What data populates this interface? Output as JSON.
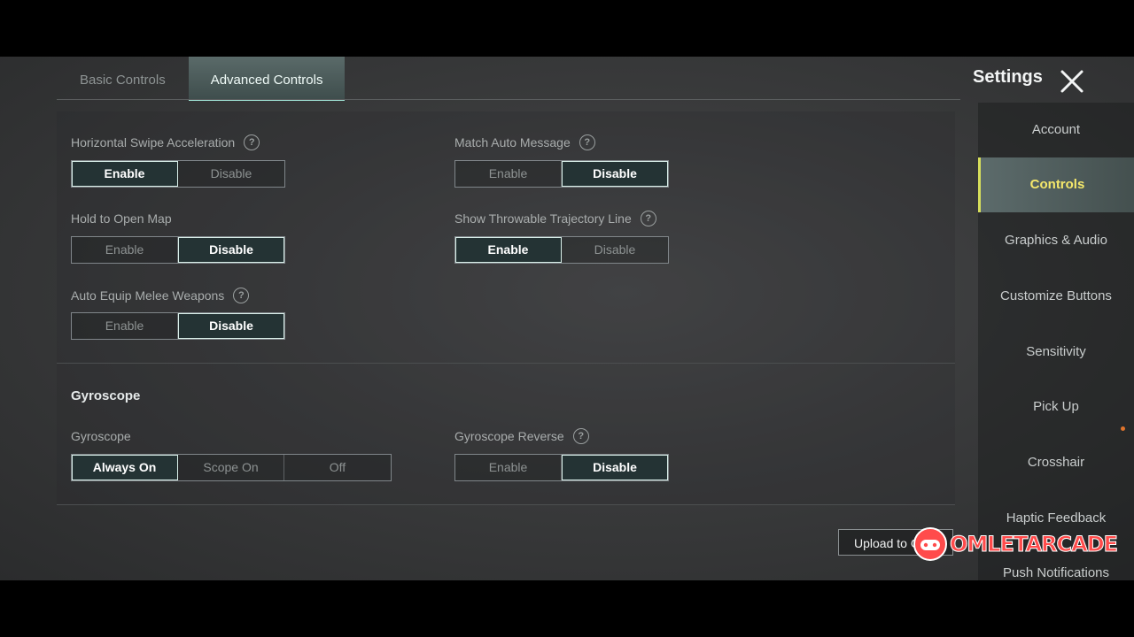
{
  "tabs": {
    "basic": "Basic Controls",
    "advanced": "Advanced Controls"
  },
  "header": {
    "title": "Settings"
  },
  "settings": {
    "horizontal_swipe": {
      "label": "Horizontal Swipe Acceleration",
      "enable": "Enable",
      "disable": "Disable",
      "selected": "Enable"
    },
    "match_auto_message": {
      "label": "Match Auto Message",
      "enable": "Enable",
      "disable": "Disable",
      "selected": "Disable"
    },
    "hold_open_map": {
      "label": "Hold to Open Map",
      "enable": "Enable",
      "disable": "Disable",
      "selected": "Disable"
    },
    "throwable_trajectory": {
      "label": "Show Throwable Trajectory Line",
      "enable": "Enable",
      "disable": "Disable",
      "selected": "Enable"
    },
    "auto_equip_melee": {
      "label": "Auto Equip Melee Weapons",
      "enable": "Enable",
      "disable": "Disable",
      "selected": "Disable"
    }
  },
  "gyroscope": {
    "section_title": "Gyroscope",
    "mode": {
      "label": "Gyroscope",
      "always": "Always On",
      "scope": "Scope On",
      "off": "Off",
      "selected": "Always On"
    },
    "reverse": {
      "label": "Gyroscope Reverse",
      "enable": "Enable",
      "disable": "Disable",
      "selected": "Disable"
    }
  },
  "sidebar": {
    "items": [
      {
        "label": "Account"
      },
      {
        "label": "Controls"
      },
      {
        "label": "Graphics & Audio"
      },
      {
        "label": "Customize Buttons"
      },
      {
        "label": "Sensitivity"
      },
      {
        "label": "Pick Up"
      },
      {
        "label": "Crosshair"
      },
      {
        "label": "Haptic Feedback"
      },
      {
        "label": "Push Notifications"
      }
    ],
    "active": "Controls"
  },
  "upload_button": "Upload to C",
  "watermark": "OMLETARCADE",
  "colors": {
    "accent": "#9ee0d3",
    "active_side": "#f5e86b",
    "watermark": "#ff4b4b"
  }
}
